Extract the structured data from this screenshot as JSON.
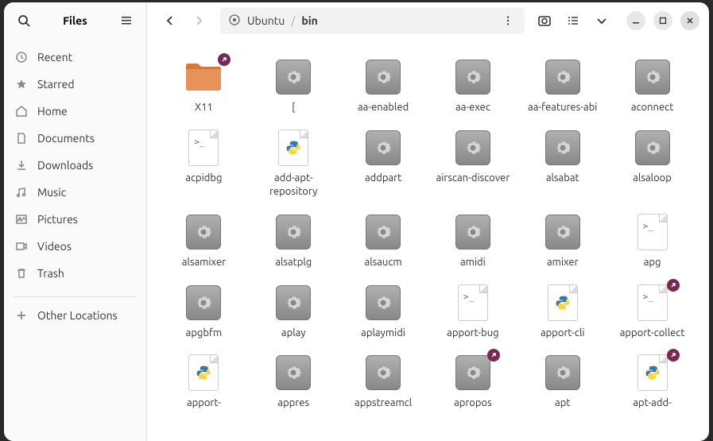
{
  "app_title": "Files",
  "sidebar": {
    "items": [
      {
        "icon": "clock",
        "label": "Recent"
      },
      {
        "icon": "star",
        "label": "Starred"
      },
      {
        "icon": "home",
        "label": "Home"
      },
      {
        "icon": "document",
        "label": "Documents"
      },
      {
        "icon": "download",
        "label": "Downloads"
      },
      {
        "icon": "music",
        "label": "Music"
      },
      {
        "icon": "picture",
        "label": "Pictures"
      },
      {
        "icon": "video",
        "label": "Videos"
      },
      {
        "icon": "trash",
        "label": "Trash"
      }
    ],
    "other_locations": "Other Locations"
  },
  "pathbar": {
    "root_icon": "disk",
    "root": "Ubuntu",
    "current": "bin"
  },
  "files": [
    {
      "name": "X11",
      "type": "folder",
      "symlink": true
    },
    {
      "name": "[",
      "type": "exec"
    },
    {
      "name": "aa-enabled",
      "type": "exec"
    },
    {
      "name": "aa-exec",
      "type": "exec"
    },
    {
      "name": "aa-features-abi",
      "type": "exec"
    },
    {
      "name": "aconnect",
      "type": "exec"
    },
    {
      "name": "acpidbg",
      "type": "script"
    },
    {
      "name": "add-apt-repository",
      "type": "python"
    },
    {
      "name": "addpart",
      "type": "exec"
    },
    {
      "name": "airscan-discover",
      "type": "exec"
    },
    {
      "name": "alsabat",
      "type": "exec"
    },
    {
      "name": "alsaloop",
      "type": "exec"
    },
    {
      "name": "alsamixer",
      "type": "exec"
    },
    {
      "name": "alsatplg",
      "type": "exec"
    },
    {
      "name": "alsaucm",
      "type": "exec"
    },
    {
      "name": "amidi",
      "type": "exec"
    },
    {
      "name": "amixer",
      "type": "exec"
    },
    {
      "name": "apg",
      "type": "script"
    },
    {
      "name": "apgbfm",
      "type": "exec"
    },
    {
      "name": "aplay",
      "type": "exec"
    },
    {
      "name": "aplaymidi",
      "type": "exec"
    },
    {
      "name": "apport-bug",
      "type": "script"
    },
    {
      "name": "apport-cli",
      "type": "python"
    },
    {
      "name": "apport-collect",
      "type": "script",
      "symlink": true
    },
    {
      "name": "apport-",
      "type": "python"
    },
    {
      "name": "appres",
      "type": "exec"
    },
    {
      "name": "appstreamcl",
      "type": "exec"
    },
    {
      "name": "apropos",
      "type": "exec",
      "symlink": true
    },
    {
      "name": "apt",
      "type": "exec"
    },
    {
      "name": "apt-add-",
      "type": "python",
      "symlink": true
    }
  ]
}
